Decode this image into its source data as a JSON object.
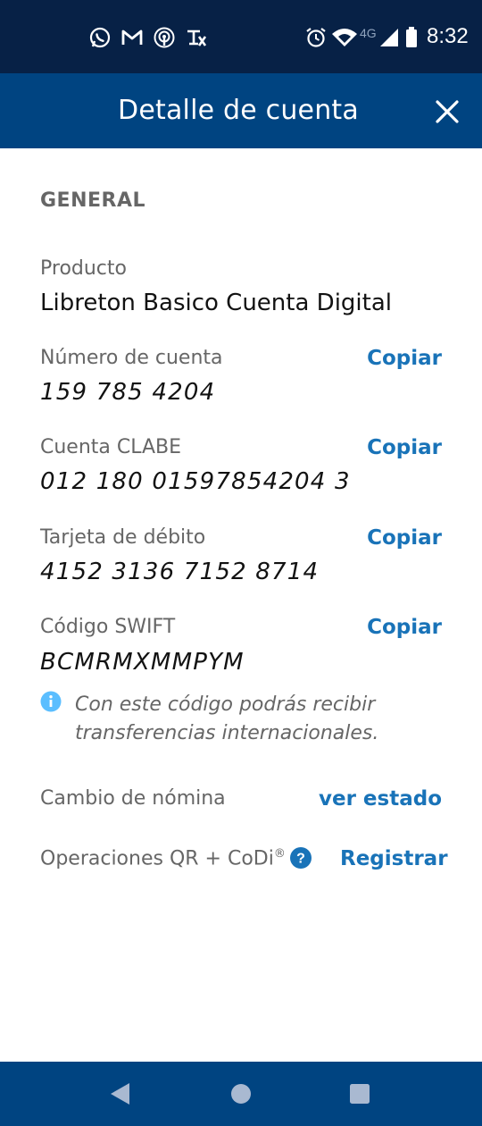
{
  "status_bar": {
    "time": "8:32",
    "network": "4G",
    "notification_icons": [
      "whatsapp-icon",
      "gmail-icon",
      "podcast-icon",
      "translate-icon"
    ],
    "system_icons": [
      "alarm-icon",
      "wifi-icon",
      "signal-icon",
      "battery-icon"
    ]
  },
  "header": {
    "title": "Detalle de cuenta",
    "close_icon": "close-icon"
  },
  "general": {
    "section_title": "GENERAL",
    "product_label": "Producto",
    "product_value": "Libreton Basico Cuenta Digital",
    "copy_label": "Copiar",
    "fields": [
      {
        "label": "Número de cuenta",
        "value": "159 785 4204"
      },
      {
        "label": "Cuenta CLABE",
        "value": "012 180 01597854204 3"
      },
      {
        "label": "Tarjeta de débito",
        "value": "4152 3136 7152 8714"
      },
      {
        "label": "Código SWIFT",
        "value": "BCMRMXMMPYM"
      }
    ],
    "swift_info": "Con este código podrás recibir transferencias internacionales.",
    "payroll_label": "Cambio de nómina",
    "payroll_action": "ver estado",
    "qr_label": "Operaciones QR + CoDi",
    "qr_sup": "®",
    "qr_action": "Registrar"
  },
  "colors": {
    "status_bar_bg": "#072146",
    "header_bg": "#004481",
    "link": "#1973b8",
    "info_icon": "#5bbeff"
  },
  "nav_bar": {
    "buttons": [
      "back-icon",
      "home-icon",
      "recents-icon"
    ]
  }
}
